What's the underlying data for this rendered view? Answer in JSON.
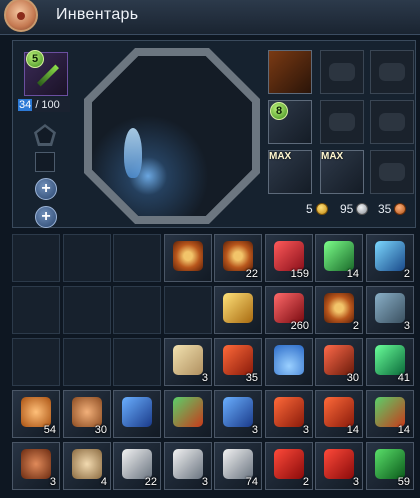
{
  "window": {
    "title": "Инвентарь"
  },
  "equipment": {
    "weapon_level": "5",
    "durability_current": "34",
    "durability_max": "/ 100",
    "necklace_level": "8",
    "ring1_badge": "MAX",
    "ring2_badge": "MAX"
  },
  "currency": {
    "gold": "5",
    "silver": "95",
    "copper": "35"
  },
  "inventory": {
    "items": [
      {
        "slot": "r0c3",
        "name": "talisman-scroll",
        "count": ""
      },
      {
        "slot": "r0c4",
        "name": "talisman-scroll",
        "count": "22"
      },
      {
        "slot": "r0c5",
        "name": "red-crystal-shard",
        "count": "159"
      },
      {
        "slot": "r0c6",
        "name": "green-crystal-shard",
        "count": "14"
      },
      {
        "slot": "r0c7",
        "name": "blue-crystal-shard",
        "count": "2"
      },
      {
        "slot": "r1c4",
        "name": "gold-ore",
        "count": ""
      },
      {
        "slot": "r1c5",
        "name": "red-ore",
        "count": "260"
      },
      {
        "slot": "r1c6",
        "name": "talisman-scroll",
        "count": "2"
      },
      {
        "slot": "r1c7",
        "name": "bundle",
        "count": "3"
      },
      {
        "slot": "r2c3",
        "name": "pastry",
        "count": "3"
      },
      {
        "slot": "r2c4",
        "name": "red-scroll",
        "count": "35"
      },
      {
        "slot": "r2c5",
        "name": "blue-powder",
        "count": ""
      },
      {
        "slot": "r2c6",
        "name": "red-hammer",
        "count": "30"
      },
      {
        "slot": "r2c7",
        "name": "green-hammer",
        "count": "41"
      },
      {
        "slot": "r3c0",
        "name": "orange-potion",
        "count": "54"
      },
      {
        "slot": "r3c1",
        "name": "soup-bowl",
        "count": "30"
      },
      {
        "slot": "r3c2",
        "name": "blue-scroll",
        "count": ""
      },
      {
        "slot": "r3c3",
        "name": "crossed-scroll",
        "count": ""
      },
      {
        "slot": "r3c4",
        "name": "blue-scroll",
        "count": "3"
      },
      {
        "slot": "r3c5",
        "name": "red-scroll",
        "count": "3"
      },
      {
        "slot": "r3c6",
        "name": "red-scroll",
        "count": "14"
      },
      {
        "slot": "r3c7",
        "name": "crossed-scroll",
        "count": "14"
      },
      {
        "slot": "r4c0",
        "name": "clay-jar",
        "count": "3"
      },
      {
        "slot": "r4c1",
        "name": "noodle-bowl",
        "count": "4"
      },
      {
        "slot": "r4c2",
        "name": "key",
        "count": "22"
      },
      {
        "slot": "r4c3",
        "name": "key",
        "count": "3"
      },
      {
        "slot": "r4c4",
        "name": "key",
        "count": "74"
      },
      {
        "slot": "r4c5",
        "name": "red-envelope",
        "count": "2"
      },
      {
        "slot": "r4c6",
        "name": "red-envelope",
        "count": "3"
      },
      {
        "slot": "r4c7",
        "name": "green-envelope",
        "count": "59"
      }
    ]
  }
}
